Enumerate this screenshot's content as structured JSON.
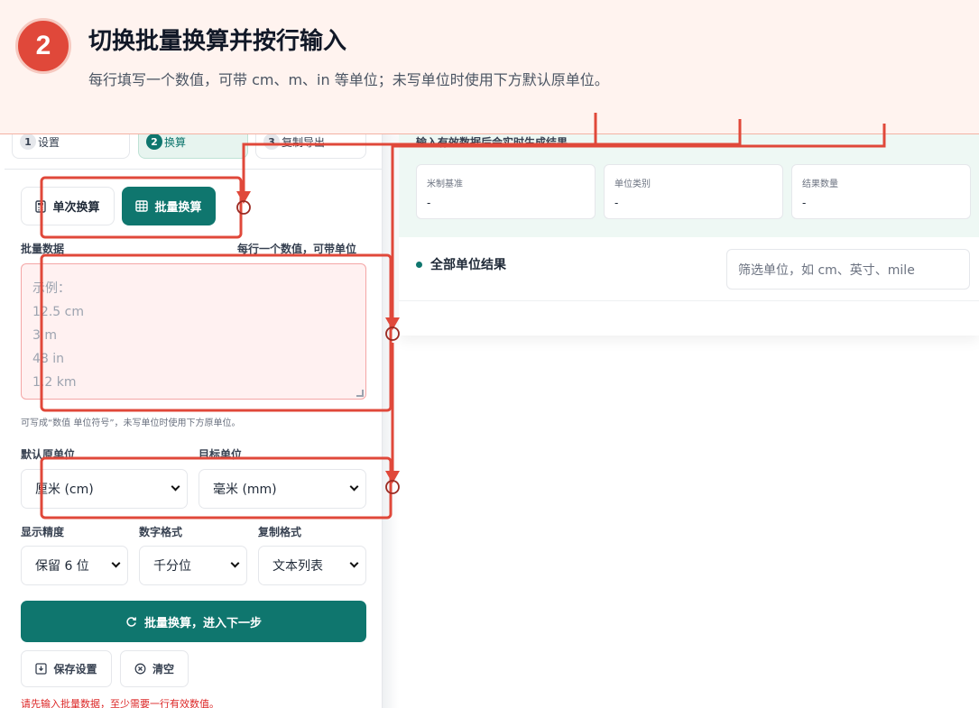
{
  "banner": {
    "step_number": "2",
    "title": "切换批量换算并按行输入",
    "subtitle": "每行填写一个数值，可带 cm、m、in 等单位；未写单位时使用下方默认原单位。"
  },
  "steps": [
    {
      "num": "1",
      "label": "设置"
    },
    {
      "num": "2",
      "label": "换算"
    },
    {
      "num": "3",
      "label": "复制导出"
    }
  ],
  "mode": {
    "single_label": "单次换算",
    "batch_label": "批量换算"
  },
  "batch": {
    "label": "批量数据",
    "hint": "每行一个数值，可带单位",
    "placeholder": "示例：\n12.5 cm\n3 m\n48 in\n1.2 km",
    "help": "可写成“数值 单位符号”，未写单位时使用下方原单位。"
  },
  "units": {
    "source_label": "默认原单位",
    "source_value": "厘米 (cm)",
    "target_label": "目标单位",
    "target_value": "毫米 (mm)"
  },
  "options": {
    "precision_label": "显示精度",
    "precision_value": "保留 6 位",
    "number_format_label": "数字格式",
    "number_format_value": "千分位",
    "copy_format_label": "复制格式",
    "copy_format_value": "文本列表"
  },
  "actions": {
    "primary_label": "批量换算，进入下一步",
    "save_label": "保存设置",
    "clear_label": "清空"
  },
  "error": "请先输入批量数据，至少需要一行有效数值。",
  "results": {
    "note": "输入有效数据后会实时生成结果",
    "cards": [
      {
        "title": "米制基准",
        "value": "-"
      },
      {
        "title": "单位类别",
        "value": "-"
      },
      {
        "title": "结果数量",
        "value": "-"
      }
    ],
    "section_title": "全部单位结果",
    "filter_placeholder": "筛选单位，如 cm、英寸、mile"
  },
  "colors": {
    "brand": "#0f766e",
    "accent_red": "#e0483a",
    "error": "#dc2626"
  }
}
